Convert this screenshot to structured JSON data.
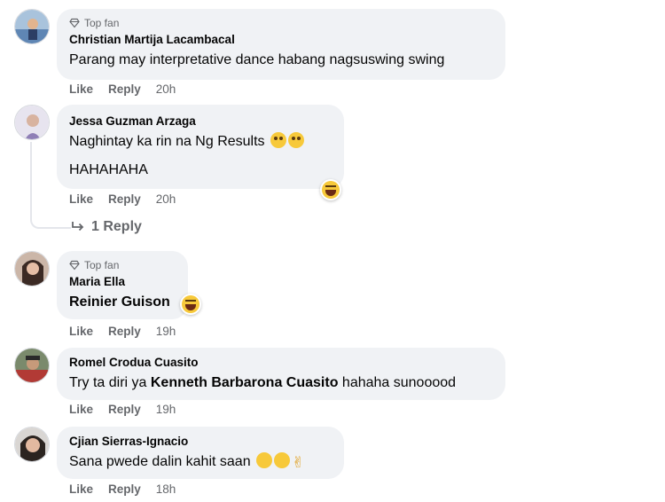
{
  "comments": [
    {
      "badge": "Top fan",
      "author": "Christian Martija Lacambacal",
      "text": "Parang may interpretative dance habang nagsuswing swing",
      "like": "Like",
      "reply": "Reply",
      "time": "20h"
    },
    {
      "author": "Jessa Guzman Arzaga",
      "text": "Naghintay ka rin na Ng Results",
      "text2": "HAHAHAHA",
      "like": "Like",
      "reply": "Reply",
      "time": "20h",
      "replies_label": "1 Reply"
    },
    {
      "badge": "Top fan",
      "author": "Maria Ella",
      "mention": "Reinier Guison",
      "like": "Like",
      "reply": "Reply",
      "time": "19h"
    },
    {
      "author": "Romel Crodua Cuasito",
      "text_before": "Try ta diri ya",
      "mention": "Kenneth Barbarona Cuasito",
      "text_after": "hahaha sunooood",
      "like": "Like",
      "reply": "Reply",
      "time": "19h"
    },
    {
      "author": "Cjian Sierras-Ignacio",
      "text": "Sana pwede dalin kahit saan",
      "like": "Like",
      "reply": "Reply",
      "time": "18h"
    }
  ],
  "icons": {
    "badge": "diamond-icon",
    "reply_arrow": "reply-arrow-icon",
    "reaction": "laughing-emoji-icon"
  },
  "colors": {
    "bubble": "#f0f2f5",
    "secondary_text": "#65676b",
    "primary_text": "#050505"
  }
}
